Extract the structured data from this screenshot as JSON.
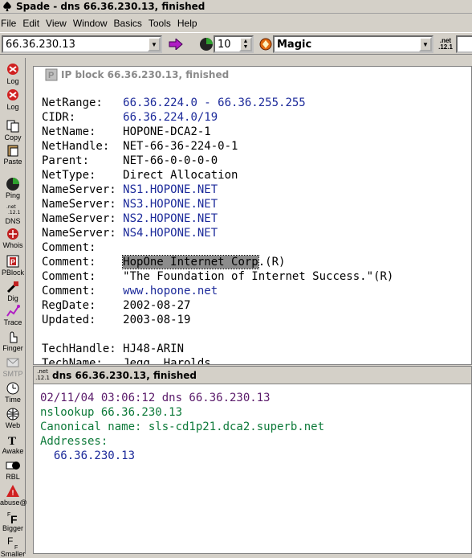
{
  "window": {
    "title": "Spade - dns 66.36.230.13, finished"
  },
  "menu": [
    "File",
    "Edit",
    "View",
    "Window",
    "Basics",
    "Tools",
    "Help"
  ],
  "toolbar": {
    "address_value": "66.36.230.13",
    "count_value": "10",
    "mode_value": "Magic",
    "net_badge": ".net\n.12.1"
  },
  "sidebar": [
    {
      "label": "Log"
    },
    {
      "label": "Log"
    },
    {
      "label": "Copy"
    },
    {
      "label": "Paste"
    },
    {
      "label": "Ping"
    },
    {
      "label": "DNS"
    },
    {
      "label": "Whois"
    },
    {
      "label": "PBlock"
    },
    {
      "label": "Dig"
    },
    {
      "label": "Trace"
    },
    {
      "label": "Finger"
    },
    {
      "label": "SMTP"
    },
    {
      "label": "Time"
    },
    {
      "label": "Web"
    },
    {
      "label": "Awake"
    },
    {
      "label": "RBL"
    },
    {
      "label": "abuse@"
    },
    {
      "label": "Bigger"
    },
    {
      "label": "Smaller"
    }
  ],
  "ipblock": {
    "title": "IP block 66.36.230.13, finished",
    "rows": [
      {
        "key": "NetRange:   ",
        "val": "66.36.224.0 - 66.36.255.255",
        "color": "blue"
      },
      {
        "key": "CIDR:       ",
        "val": "66.36.224.0/19",
        "color": "blue"
      },
      {
        "key": "NetName:    ",
        "val": "HOPONE-DCA2-1",
        "color": "black"
      },
      {
        "key": "NetHandle:  ",
        "val": "NET-66-36-224-0-1",
        "color": "black"
      },
      {
        "key": "Parent:     ",
        "val": "NET-66-0-0-0-0",
        "color": "black"
      },
      {
        "key": "NetType:    ",
        "val": "Direct Allocation",
        "color": "black"
      },
      {
        "key": "NameServer: ",
        "val": "NS1.HOPONE.NET",
        "color": "blue"
      },
      {
        "key": "NameServer: ",
        "val": "NS3.HOPONE.NET",
        "color": "blue"
      },
      {
        "key": "NameServer: ",
        "val": "NS2.HOPONE.NET",
        "color": "blue"
      },
      {
        "key": "NameServer: ",
        "val": "NS4.HOPONE.NET",
        "color": "blue"
      },
      {
        "key": "Comment:",
        "val": "",
        "color": "black"
      },
      {
        "key": "Comment:    ",
        "val": "HopOne Internet Corp",
        "suffix": ".(R)",
        "color": "highlight"
      },
      {
        "key": "Comment:    ",
        "val": "\"The Foundation of Internet Success.\"(R)",
        "color": "black"
      },
      {
        "key": "Comment:    ",
        "val": "www.hopone.net",
        "color": "blue"
      },
      {
        "key": "RegDate:    ",
        "val": "2002-08-27",
        "color": "black"
      },
      {
        "key": "Updated:    ",
        "val": "2003-08-19",
        "color": "black"
      },
      {
        "key": "",
        "val": "",
        "color": "black"
      },
      {
        "key": "TechHandle: ",
        "val": "HJ48-ARIN",
        "color": "black"
      },
      {
        "key": "TechName:   ",
        "val": "Jegg, Harolds",
        "color": "black"
      }
    ]
  },
  "dns": {
    "title": "dns 66.36.230.13, finished",
    "lines": [
      {
        "text": "02/11/04 03:06:12 dns 66.36.230.13",
        "color": "purple"
      },
      {
        "text": "nslookup 66.36.230.13",
        "color": "green"
      },
      {
        "text": "Canonical name: sls-cd1p21.dca2.superb.net",
        "color": "green"
      },
      {
        "text": "Addresses:",
        "color": "green"
      },
      {
        "text": "  66.36.230.13",
        "color": "navy"
      }
    ]
  }
}
